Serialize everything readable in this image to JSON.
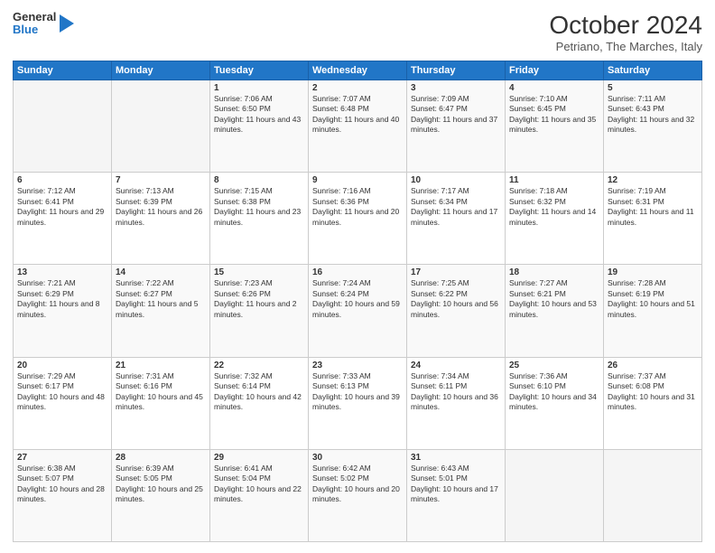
{
  "header": {
    "logo_line1": "General",
    "logo_line2": "Blue",
    "month_title": "October 2024",
    "location": "Petriano, The Marches, Italy"
  },
  "days_of_week": [
    "Sunday",
    "Monday",
    "Tuesday",
    "Wednesday",
    "Thursday",
    "Friday",
    "Saturday"
  ],
  "weeks": [
    [
      {
        "day": "",
        "info": ""
      },
      {
        "day": "",
        "info": ""
      },
      {
        "day": "1",
        "info": "Sunrise: 7:06 AM\nSunset: 6:50 PM\nDaylight: 11 hours and 43 minutes."
      },
      {
        "day": "2",
        "info": "Sunrise: 7:07 AM\nSunset: 6:48 PM\nDaylight: 11 hours and 40 minutes."
      },
      {
        "day": "3",
        "info": "Sunrise: 7:09 AM\nSunset: 6:47 PM\nDaylight: 11 hours and 37 minutes."
      },
      {
        "day": "4",
        "info": "Sunrise: 7:10 AM\nSunset: 6:45 PM\nDaylight: 11 hours and 35 minutes."
      },
      {
        "day": "5",
        "info": "Sunrise: 7:11 AM\nSunset: 6:43 PM\nDaylight: 11 hours and 32 minutes."
      }
    ],
    [
      {
        "day": "6",
        "info": "Sunrise: 7:12 AM\nSunset: 6:41 PM\nDaylight: 11 hours and 29 minutes."
      },
      {
        "day": "7",
        "info": "Sunrise: 7:13 AM\nSunset: 6:39 PM\nDaylight: 11 hours and 26 minutes."
      },
      {
        "day": "8",
        "info": "Sunrise: 7:15 AM\nSunset: 6:38 PM\nDaylight: 11 hours and 23 minutes."
      },
      {
        "day": "9",
        "info": "Sunrise: 7:16 AM\nSunset: 6:36 PM\nDaylight: 11 hours and 20 minutes."
      },
      {
        "day": "10",
        "info": "Sunrise: 7:17 AM\nSunset: 6:34 PM\nDaylight: 11 hours and 17 minutes."
      },
      {
        "day": "11",
        "info": "Sunrise: 7:18 AM\nSunset: 6:32 PM\nDaylight: 11 hours and 14 minutes."
      },
      {
        "day": "12",
        "info": "Sunrise: 7:19 AM\nSunset: 6:31 PM\nDaylight: 11 hours and 11 minutes."
      }
    ],
    [
      {
        "day": "13",
        "info": "Sunrise: 7:21 AM\nSunset: 6:29 PM\nDaylight: 11 hours and 8 minutes."
      },
      {
        "day": "14",
        "info": "Sunrise: 7:22 AM\nSunset: 6:27 PM\nDaylight: 11 hours and 5 minutes."
      },
      {
        "day": "15",
        "info": "Sunrise: 7:23 AM\nSunset: 6:26 PM\nDaylight: 11 hours and 2 minutes."
      },
      {
        "day": "16",
        "info": "Sunrise: 7:24 AM\nSunset: 6:24 PM\nDaylight: 10 hours and 59 minutes."
      },
      {
        "day": "17",
        "info": "Sunrise: 7:25 AM\nSunset: 6:22 PM\nDaylight: 10 hours and 56 minutes."
      },
      {
        "day": "18",
        "info": "Sunrise: 7:27 AM\nSunset: 6:21 PM\nDaylight: 10 hours and 53 minutes."
      },
      {
        "day": "19",
        "info": "Sunrise: 7:28 AM\nSunset: 6:19 PM\nDaylight: 10 hours and 51 minutes."
      }
    ],
    [
      {
        "day": "20",
        "info": "Sunrise: 7:29 AM\nSunset: 6:17 PM\nDaylight: 10 hours and 48 minutes."
      },
      {
        "day": "21",
        "info": "Sunrise: 7:31 AM\nSunset: 6:16 PM\nDaylight: 10 hours and 45 minutes."
      },
      {
        "day": "22",
        "info": "Sunrise: 7:32 AM\nSunset: 6:14 PM\nDaylight: 10 hours and 42 minutes."
      },
      {
        "day": "23",
        "info": "Sunrise: 7:33 AM\nSunset: 6:13 PM\nDaylight: 10 hours and 39 minutes."
      },
      {
        "day": "24",
        "info": "Sunrise: 7:34 AM\nSunset: 6:11 PM\nDaylight: 10 hours and 36 minutes."
      },
      {
        "day": "25",
        "info": "Sunrise: 7:36 AM\nSunset: 6:10 PM\nDaylight: 10 hours and 34 minutes."
      },
      {
        "day": "26",
        "info": "Sunrise: 7:37 AM\nSunset: 6:08 PM\nDaylight: 10 hours and 31 minutes."
      }
    ],
    [
      {
        "day": "27",
        "info": "Sunrise: 6:38 AM\nSunset: 5:07 PM\nDaylight: 10 hours and 28 minutes."
      },
      {
        "day": "28",
        "info": "Sunrise: 6:39 AM\nSunset: 5:05 PM\nDaylight: 10 hours and 25 minutes."
      },
      {
        "day": "29",
        "info": "Sunrise: 6:41 AM\nSunset: 5:04 PM\nDaylight: 10 hours and 22 minutes."
      },
      {
        "day": "30",
        "info": "Sunrise: 6:42 AM\nSunset: 5:02 PM\nDaylight: 10 hours and 20 minutes."
      },
      {
        "day": "31",
        "info": "Sunrise: 6:43 AM\nSunset: 5:01 PM\nDaylight: 10 hours and 17 minutes."
      },
      {
        "day": "",
        "info": ""
      },
      {
        "day": "",
        "info": ""
      }
    ]
  ]
}
